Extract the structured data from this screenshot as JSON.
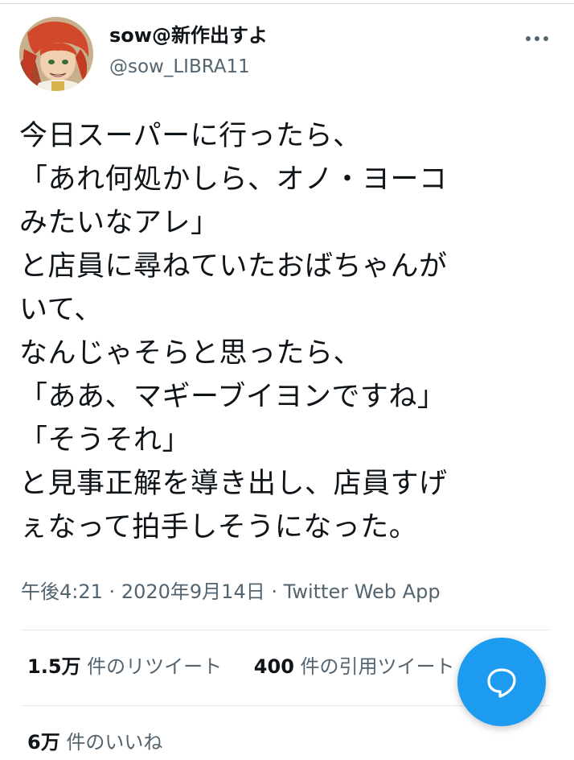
{
  "author": {
    "display_name": "sow@新作出すよ",
    "handle": "@sow_LIBRA11"
  },
  "tweet": {
    "lines": [
      "今日スーパーに行ったら、",
      "「あれ何処かしら、オノ・ヨーコ",
      "みたいなアレ」",
      "と店員に尋ねていたおばちゃんが",
      "いて、",
      "なんじゃそらと思ったら、",
      "「ああ、マギーブイヨンですね」",
      "「そうそれ」",
      "と見事正解を導き出し、店員すげ",
      "ぇなって拍手しそうになった。"
    ],
    "time": "午後4:21",
    "date": "2020年9月14日",
    "separator": "·",
    "source": "Twitter Web App"
  },
  "stats": {
    "retweets_count": "1.5万",
    "retweets_label": "件のリツイート",
    "quotes_count": "400",
    "quotes_label": "件の引用ツイート",
    "likes_count": "6万",
    "likes_label": "件のいいね"
  },
  "icons": {
    "more": "more-dots-icon",
    "compose": "compose-reply-icon"
  },
  "colors": {
    "accent": "#1d9bf0",
    "secondary_text": "#536471",
    "primary_text": "#0f1419"
  }
}
